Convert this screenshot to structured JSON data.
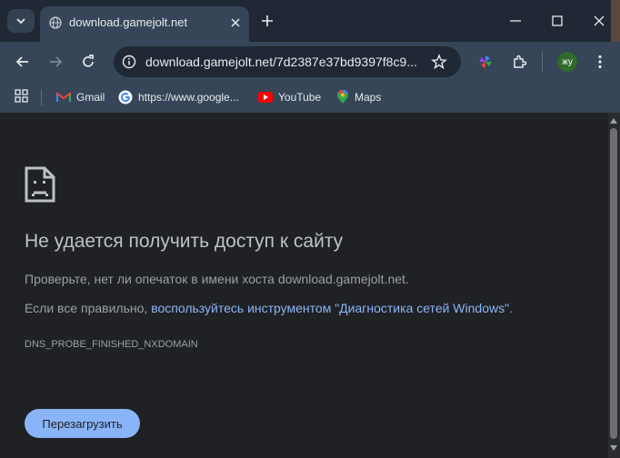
{
  "tab": {
    "title": "download.gamejolt.net"
  },
  "omnibox": {
    "url": "download.gamejolt.net/7d2387e37bd9397f8c9..."
  },
  "profile": {
    "initials": "жу"
  },
  "bookmarks": [
    {
      "label": "Gmail",
      "icon": "gmail-icon"
    },
    {
      "label": "https://www.google...",
      "icon": "google-icon"
    },
    {
      "label": "YouTube",
      "icon": "youtube-icon"
    },
    {
      "label": "Maps",
      "icon": "maps-icon"
    }
  ],
  "error": {
    "heading": "Не удается получить доступ к сайту",
    "line1": "Проверьте, нет ли опечаток в имени хоста download.gamejolt.net.",
    "line2_prefix": "Если все правильно, ",
    "line2_link": "воспользуйтесь инструментом \"Диагностика сетей Windows\"",
    "line2_suffix": ".",
    "code": "DNS_PROBE_FINISHED_NXDOMAIN",
    "reload_label": "Перезагрузить"
  },
  "colors": {
    "accent": "#8ab4f8",
    "background": "#202124",
    "frame": "#1f2834",
    "toolbar": "#364558"
  }
}
